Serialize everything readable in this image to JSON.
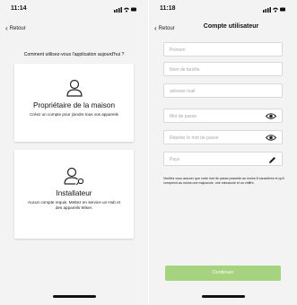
{
  "left": {
    "time": "11:14",
    "back_label": "Retour",
    "question": "Comment utilisez-vous l'application aujourd'hui ?",
    "cards": [
      {
        "title": "Propriétaire de la maison",
        "description": "Créez un compte pour joindre tous vos appareils",
        "icon": "person-icon"
      },
      {
        "title": "Installateur",
        "description": "Aucun compte requis. Mettez en service un Hub et des appareils Wiser.",
        "icon": "person-wrench-icon"
      }
    ]
  },
  "right": {
    "time": "11:18",
    "back_label": "Retour",
    "title": "Compte utilisateur",
    "fields": [
      {
        "placeholder": "Prénom"
      },
      {
        "placeholder": "Nom de famille"
      },
      {
        "placeholder": "adresse mail"
      },
      {
        "placeholder": "Mot de passe",
        "icon": "eye-icon"
      },
      {
        "placeholder": "Répéter le mot de passe",
        "icon": "eye-icon"
      },
      {
        "placeholder": "Pays",
        "icon": "pencil-icon"
      }
    ],
    "hint": "Veuillez vous assurer que votre mot de passe possède au moins 8 caractères et qu'il comprend au moins une majuscule, une minuscule et un chiffre.",
    "continue_label": "Continuer",
    "continue_color": "#a6d37e"
  }
}
